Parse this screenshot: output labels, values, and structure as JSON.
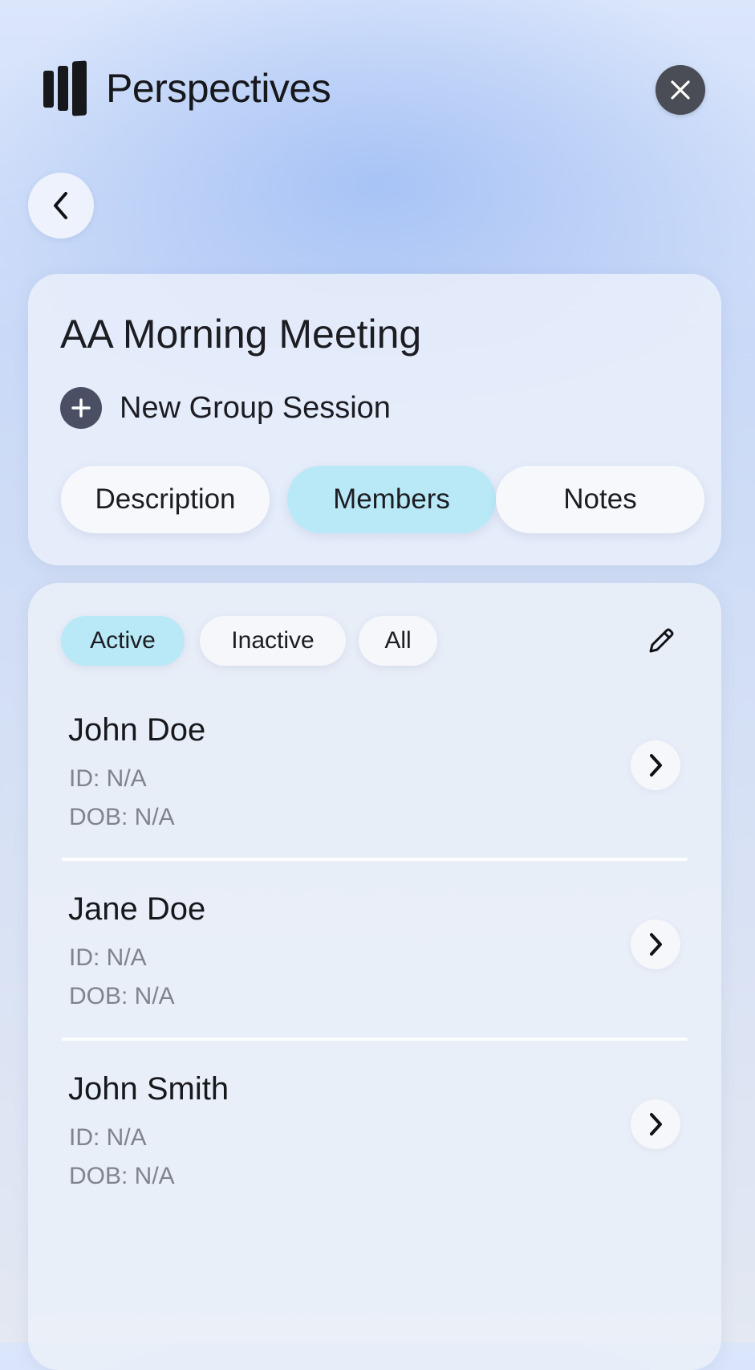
{
  "app": {
    "name": "Perspectives",
    "logo_icon": "bars-logo-icon"
  },
  "header": {
    "close_icon": "close-icon",
    "back_icon": "chevron-left-icon"
  },
  "group": {
    "title": "AA Morning Meeting",
    "new_session_label": "New Group Session",
    "new_session_icon": "plus-circle-icon",
    "tabs": [
      {
        "label": "Description",
        "active": false
      },
      {
        "label": "Members",
        "active": true
      },
      {
        "label": "Notes",
        "active": false
      }
    ]
  },
  "members_panel": {
    "filters": [
      {
        "label": "Active",
        "active": true
      },
      {
        "label": "Inactive",
        "active": false
      },
      {
        "label": "All",
        "active": false
      }
    ],
    "edit_icon": "pencil-icon",
    "members": [
      {
        "name": "John Doe",
        "id": "ID: N/A",
        "dob": "DOB: N/A"
      },
      {
        "name": "Jane Doe",
        "id": "ID: N/A",
        "dob": "DOB: N/A"
      },
      {
        "name": "John Smith",
        "id": "ID: N/A",
        "dob": "DOB: N/A"
      }
    ],
    "row_icon": "chevron-right-icon"
  },
  "colors": {
    "active_pill": "#b9e9f6",
    "pill": "#f7f8fb",
    "close_button": "#4a4d55",
    "plus_circle": "#4a4f63",
    "secondary_text": "#80838b"
  }
}
